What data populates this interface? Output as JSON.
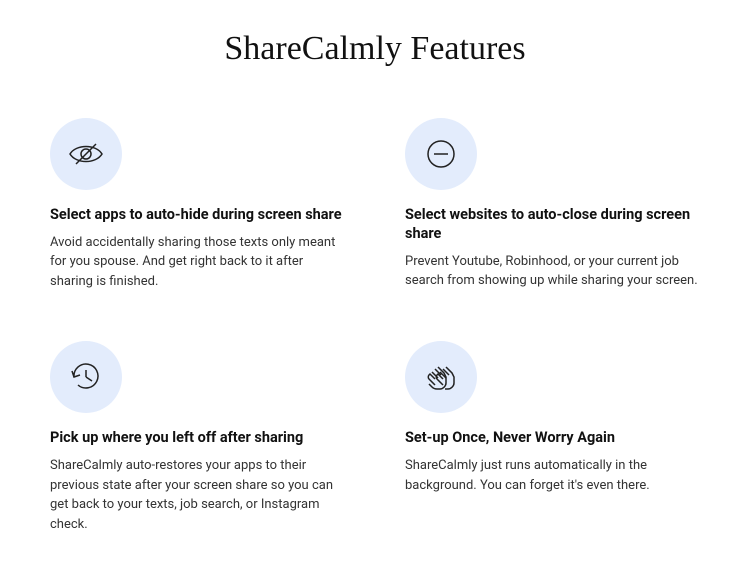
{
  "title": "ShareCalmly Features",
  "features": [
    {
      "title": "Select apps to auto-hide during screen share",
      "desc": "Avoid accidentally sharing those texts only meant for you spouse. And get right back to it after sharing is finished."
    },
    {
      "title": "Select websites to auto-close during screen share",
      "desc": "Prevent Youtube, Robinhood, or your current job search from showing up while sharing your screen."
    },
    {
      "title": "Pick up where you left off after sharing",
      "desc": "ShareCalmly auto-restores your apps to their previous state after your screen share so you can get back to your texts, job search, or Instagram check."
    },
    {
      "title": "Set-up Once, Never Worry Again",
      "desc": "ShareCalmly just runs automatically in the background. You can forget it's even there."
    }
  ]
}
